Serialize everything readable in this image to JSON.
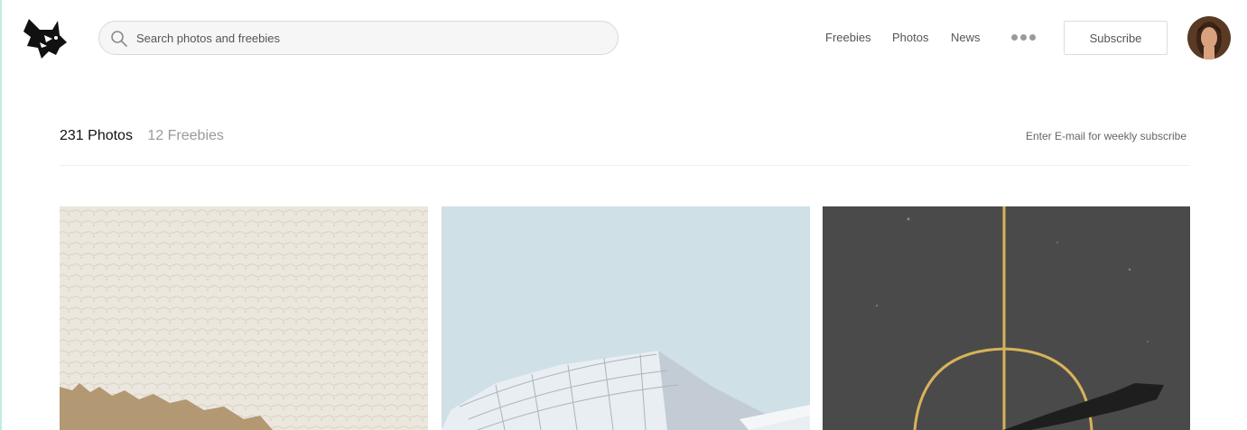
{
  "header": {
    "logo_icon": "wolf-logo-icon",
    "search": {
      "icon": "search-icon",
      "placeholder": "Search photos and freebies",
      "value": ""
    },
    "nav": [
      {
        "label": "Freebies"
      },
      {
        "label": "Photos"
      },
      {
        "label": "News"
      }
    ],
    "more_icon": "more-dots-icon",
    "subscribe_label": "Subscribe",
    "avatar_icon": "user-avatar"
  },
  "stats": {
    "photos_label": "231 Photos",
    "freebies_label": "12 Freebies",
    "email_hint": "Enter E-mail for weekly subscribe"
  },
  "colors": {
    "accent": "#bfeee2",
    "photo_sky": "#cfe0e7",
    "photo_wall": "#ece6dc",
    "photo_sand": "#b39874",
    "photo_court": "#4a4a4a",
    "court_line": "#d7b25a"
  }
}
